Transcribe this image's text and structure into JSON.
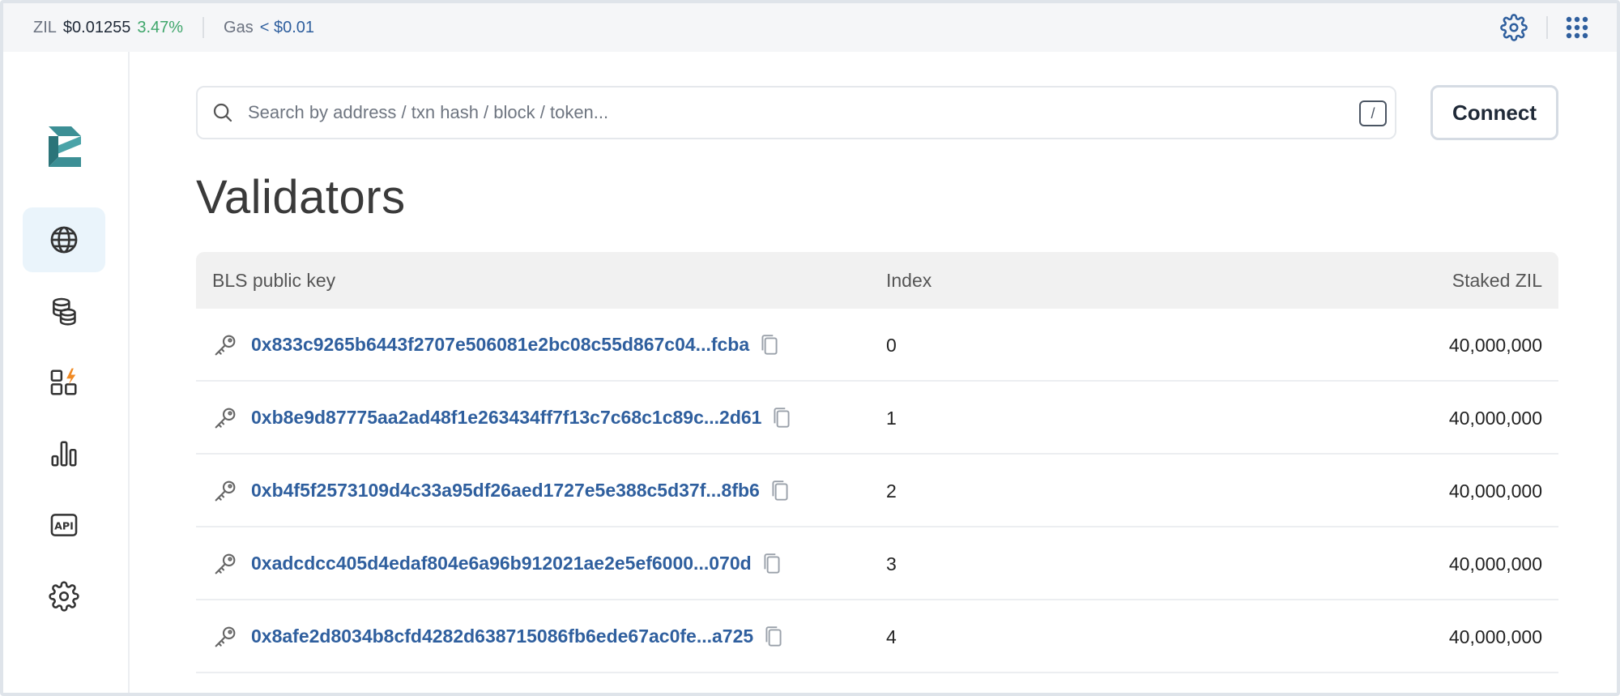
{
  "topbar": {
    "token": "ZIL",
    "price": "$0.01255",
    "change": "3.47%",
    "gas_label": "Gas",
    "gas_value": "< $0.01"
  },
  "search": {
    "placeholder": "Search by address / txn hash / block / token...",
    "shortcut": "/"
  },
  "header": {
    "connect_label": "Connect"
  },
  "page": {
    "title": "Validators"
  },
  "table": {
    "columns": [
      "BLS public key",
      "Index",
      "Staked ZIL"
    ],
    "rows": [
      {
        "key": "0x833c9265b6443f2707e506081e2bc08c55d867c04...fcba",
        "index": "0",
        "staked": "40,000,000"
      },
      {
        "key": "0xb8e9d87775aa2ad48f1e263434ff7f13c7c68c1c89c...2d61",
        "index": "1",
        "staked": "40,000,000"
      },
      {
        "key": "0xb4f5f2573109d4c33a95df26aed1727e5e388c5d37f...8fb6",
        "index": "2",
        "staked": "40,000,000"
      },
      {
        "key": "0xadcdcc405d4edaf804e6a96b912021ae2e5ef6000...070d",
        "index": "3",
        "staked": "40,000,000"
      },
      {
        "key": "0x8afe2d8034b8cfd4282d638715086fb6ede67ac0fe...a725",
        "index": "4",
        "staked": "40,000,000"
      }
    ]
  },
  "sidebar": {
    "items": [
      {
        "icon": "globe-icon",
        "active": true
      },
      {
        "icon": "coins-icon",
        "active": false
      },
      {
        "icon": "apps-icon",
        "active": false
      },
      {
        "icon": "bar-chart-icon",
        "active": false
      },
      {
        "icon": "api-icon",
        "active": false
      },
      {
        "icon": "gear-icon",
        "active": false
      }
    ]
  },
  "colors": {
    "link": "#2f5f9e",
    "positive": "#3fa66b",
    "active_nav_bg": "#eaf4fb",
    "logo": "#4aa3a8"
  }
}
